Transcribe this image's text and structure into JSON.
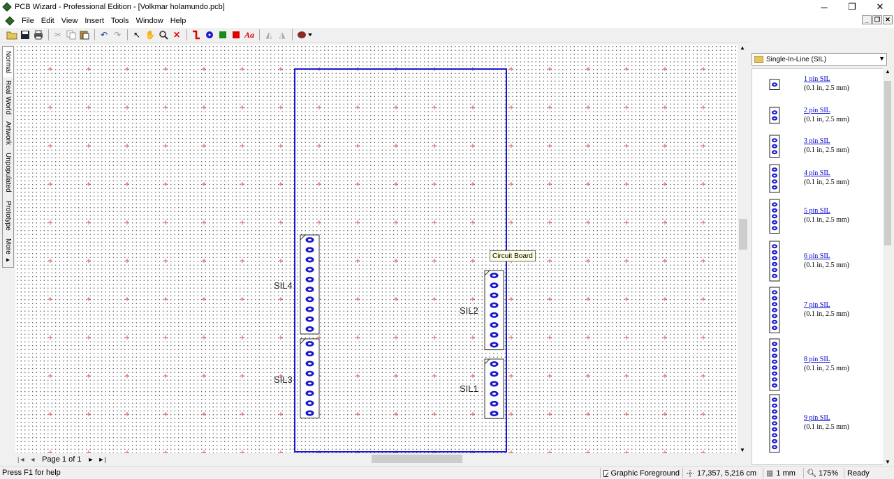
{
  "window": {
    "title": "PCB Wizard - Professional Edition - [Volkmar holamundo.pcb]",
    "minimize": "─",
    "restore": "❐",
    "close": "✕"
  },
  "menu": {
    "items": [
      "File",
      "Edit",
      "View",
      "Insert",
      "Tools",
      "Window",
      "Help"
    ]
  },
  "mdi": {
    "minimize": "_",
    "restore": "❐",
    "close": "✕"
  },
  "toolbar": {
    "text_tool": "Aa"
  },
  "side_tabs": [
    "Normal",
    "Real World",
    "Artwork",
    "Unpopulated",
    "Prototype",
    "More ▸"
  ],
  "canvas": {
    "tooltip": "Circuit Board",
    "components": [
      {
        "label": "SIL4",
        "pins": 10
      },
      {
        "label": "SIL3",
        "pins": 8
      },
      {
        "label": "SIL2",
        "pins": 8
      },
      {
        "label": "SIL1",
        "pins": 6
      }
    ]
  },
  "page_nav": {
    "label": "Page 1 of 1",
    "first": "|◄",
    "prev": "◄",
    "next": "►",
    "last": "►|"
  },
  "gallery": {
    "category": "Single-In-Line (SIL)",
    "items": [
      {
        "name": "1 pin SIL",
        "spec": "(0.1 in, 2.5 mm)",
        "pins": 1
      },
      {
        "name": "2 pin SIL",
        "spec": "(0.1 in, 2.5 mm)",
        "pins": 2
      },
      {
        "name": "3 pin SIL",
        "spec": "(0.1 in, 2.5 mm)",
        "pins": 3
      },
      {
        "name": "4 pin SIL",
        "spec": "(0.1 in, 2.5 mm)",
        "pins": 4
      },
      {
        "name": "5 pin SIL",
        "spec": "(0.1 in, 2.5 mm)",
        "pins": 5
      },
      {
        "name": "6 pin SIL",
        "spec": "(0.1 in, 2.5 mm)",
        "pins": 6
      },
      {
        "name": "7 pin SIL",
        "spec": "(0.1 in, 2.5 mm)",
        "pins": 7
      },
      {
        "name": "8 pin SIL",
        "spec": "(0.1 in, 2.5 mm)",
        "pins": 8
      },
      {
        "name": "9 pin SIL",
        "spec": "(0.1 in, 2.5 mm)",
        "pins": 9
      }
    ]
  },
  "status": {
    "help": "Press F1 for help",
    "layer": "Graphic Foreground",
    "coords": "17,357, 5,216 cm",
    "grid": "1 mm",
    "zoom": "175%",
    "state": "Ready"
  },
  "colors": {
    "board": "#1a1acc",
    "pad": "#1a1acc",
    "grid_cross": "#e03030"
  }
}
